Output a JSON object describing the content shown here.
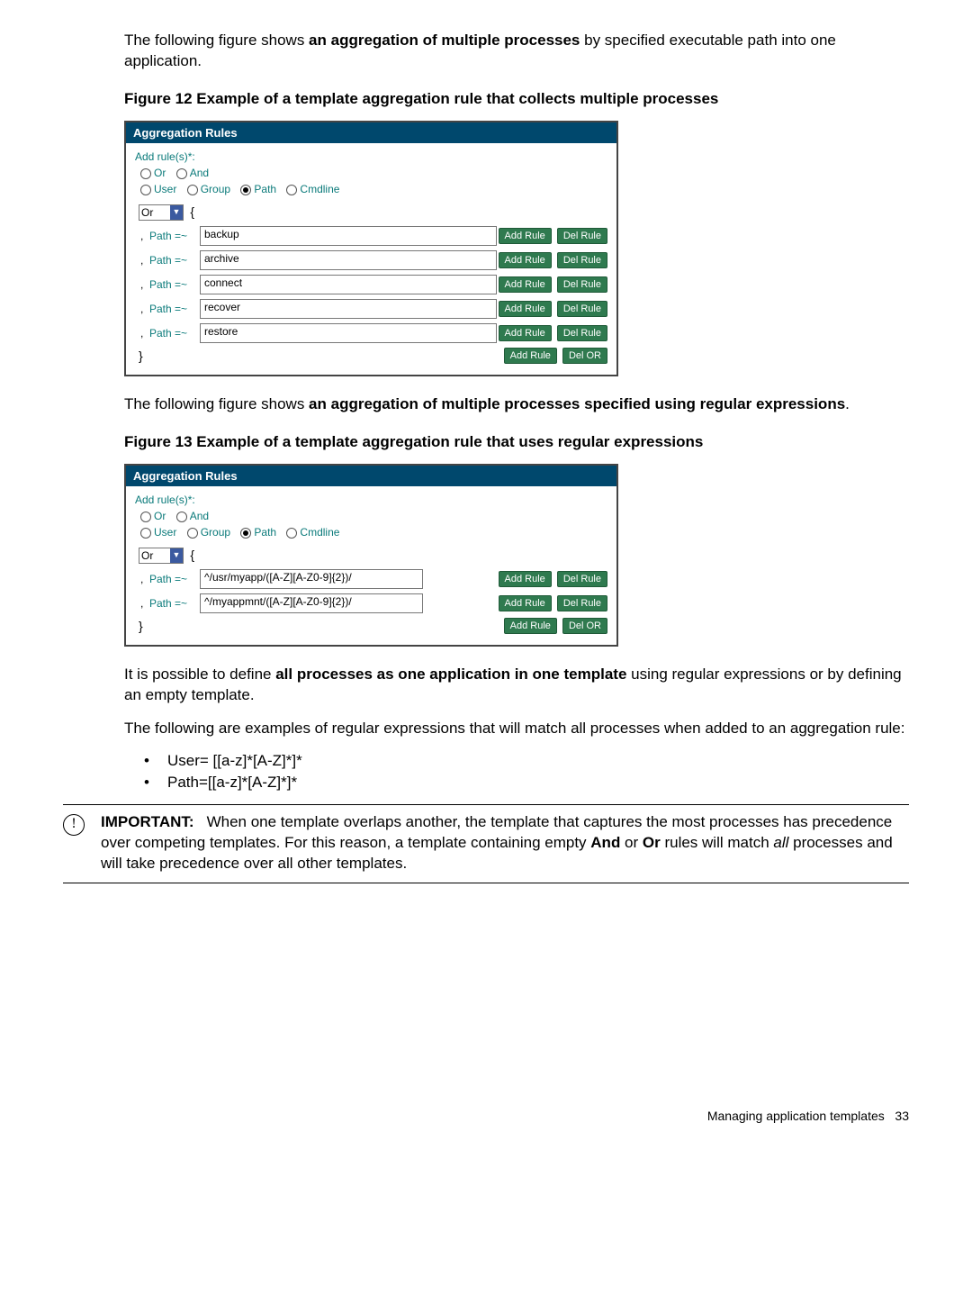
{
  "intro1_a": "The following figure shows ",
  "intro1_bold": "an aggregation of multiple processes",
  "intro1_b": " by specified executable path into one application.",
  "fig12_caption": "Figure 12 Example of a template aggregation rule that collects multiple processes",
  "intro2_a": "The following figure shows ",
  "intro2_bold": "an aggregation of multiple processes specified using regular expressions",
  "intro2_b": ".",
  "fig13_caption": "Figure 13 Example of a template aggregation rule that uses regular expressions",
  "para_all_a": "It is possible to define ",
  "para_all_bold": "all processes as one application in one template",
  "para_all_b": " using regular expressions or by defining an empty template.",
  "para_examples": "The following are examples of regular expressions that will match all processes when added to an aggregation rule:",
  "bullet1": "User= [[a-z]*[A-Z]*]*",
  "bullet2": "Path=[[a-z]*[A-Z]*]*",
  "important_label": "IMPORTANT:",
  "important_text_a": "When one template overlaps another, the template that captures the most processes has precedence over competing templates. For this reason, a template containing empty ",
  "important_and": "And",
  "important_text_b": " or ",
  "important_or": "Or",
  "important_text_c": " rules will match ",
  "important_all": "all",
  "important_text_d": " processes and will take precedence over all other templates.",
  "footer_text": "Managing application templates",
  "footer_page": "33",
  "panel": {
    "title": "Aggregation Rules",
    "add_label": "Add rule(s)*:",
    "r1": {
      "or": "Or",
      "and": "And"
    },
    "r2": {
      "user": "User",
      "group": "Group",
      "path": "Path",
      "cmd": "Cmdline"
    },
    "or_select": "Or",
    "path_label": "Path =~",
    "btn_add": "Add Rule",
    "btn_del": "Del Rule",
    "btn_delor": "Del OR"
  },
  "fig12_rules": [
    "backup",
    "archive",
    "connect",
    "recover",
    "restore"
  ],
  "fig13_rules": [
    "^/usr/myapp/([A-Z][A-Z0-9]{2})/",
    "^/myappmnt/([A-Z][A-Z0-9]{2})/"
  ]
}
